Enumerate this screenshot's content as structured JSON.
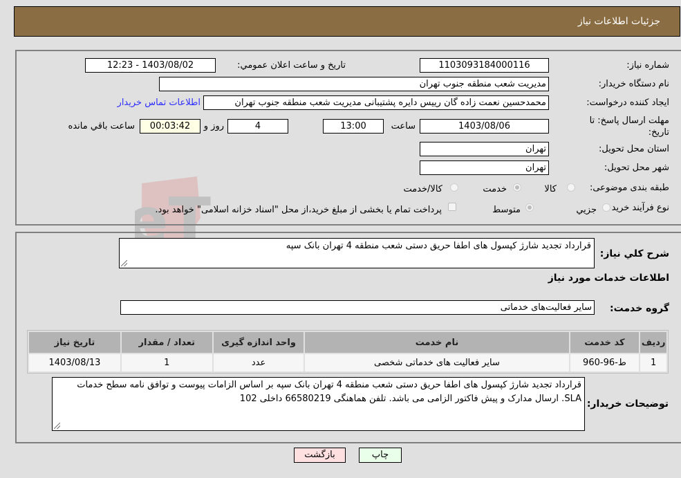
{
  "header": {
    "title": "جزئیات اطلاعات نیاز"
  },
  "details": {
    "need_number_label": "شماره نیاز:",
    "need_number": "1103093184000116",
    "announce_label": "تاریخ و ساعت اعلان عمومي:",
    "announce_value": "1403/08/02 - 12:23",
    "buyer_org_label": "نام دستگاه خريدار:",
    "buyer_org": "مدیریت شعب منطقه جنوب تهران",
    "creator_label": "ایجاد کننده درخواست:",
    "creator": "محمدحسین نعمت زاده گان رییس دایره پشتیبانی مدیریت شعب منطقه جنوب تهران",
    "contact_link": "اطلاعات تماس خریدار",
    "deadline_label_line1": "مهلت ارسال پاسخ: تا",
    "deadline_label_line2": "تاریخ:",
    "deadline_date": "1403/08/06",
    "time_label": "ساعت",
    "deadline_time": "13:00",
    "days_value": "4",
    "days_label": "روز و",
    "remaining_time": "00:03:42",
    "remaining_label": "ساعت باقي مانده",
    "province_label": "استان محل تحویل:",
    "province": "تهران",
    "city_label": "شهر محل تحویل:",
    "city": "تهران",
    "category_label": "طبقه بندی موضوعی:",
    "category_options": [
      "کالا",
      "خدمت",
      "کالا/خدمت"
    ],
    "category_selected": "خدمت",
    "process_label": "نوع فرآیند خرید :",
    "process_options": [
      "جزيي",
      "متوسط"
    ],
    "process_selected": "متوسط",
    "treasury_note": "پرداخت تمام یا بخشی از مبلغ خرید،از محل \"اسناد خزانه اسلامی\" خواهد بود."
  },
  "summary": {
    "label": "شرح کلي نياز:",
    "text": "قرارداد تجدید شارژ کپسول های اطفا حریق دستی شعب منطقه 4 تهران بانک سپه"
  },
  "services": {
    "section_title": "اطلاعات خدمات مورد نیاز",
    "group_label": "گروه خدمت:",
    "group_value": "سایر فعالیت‌های خدماتی",
    "columns": [
      "ردیف",
      "کد خدمت",
      "نام خدمت",
      "واحد اندازه گیری",
      "تعداد / مقدار",
      "تاریخ نیاز"
    ],
    "rows": [
      [
        "1",
        "ط-96-960",
        "سایر فعالیت های خدماتی شخصی",
        "عدد",
        "1",
        "1403/08/13"
      ]
    ]
  },
  "buyer_notes": {
    "label": "توضیحات خریدار:",
    "text": "قرارداد تجدید شارژ کپسول های اطفا حریق دستی شعب منطقه 4 تهران بانک سپه بر اساس الزامات پیوست و توافق نامه سطح خدمات SLA. ارسال مدارک و پیش فاکتور الزامی می باشد. تلفن هماهنگی 66580219 داخلی 102"
  },
  "buttons": {
    "print": "چاپ",
    "back": "بازگشت"
  },
  "colors": {
    "header_bg": "#8b6d43",
    "print_bg": "#eaffea",
    "back_bg": "#ffe0e0",
    "link": "#2d2dff"
  }
}
